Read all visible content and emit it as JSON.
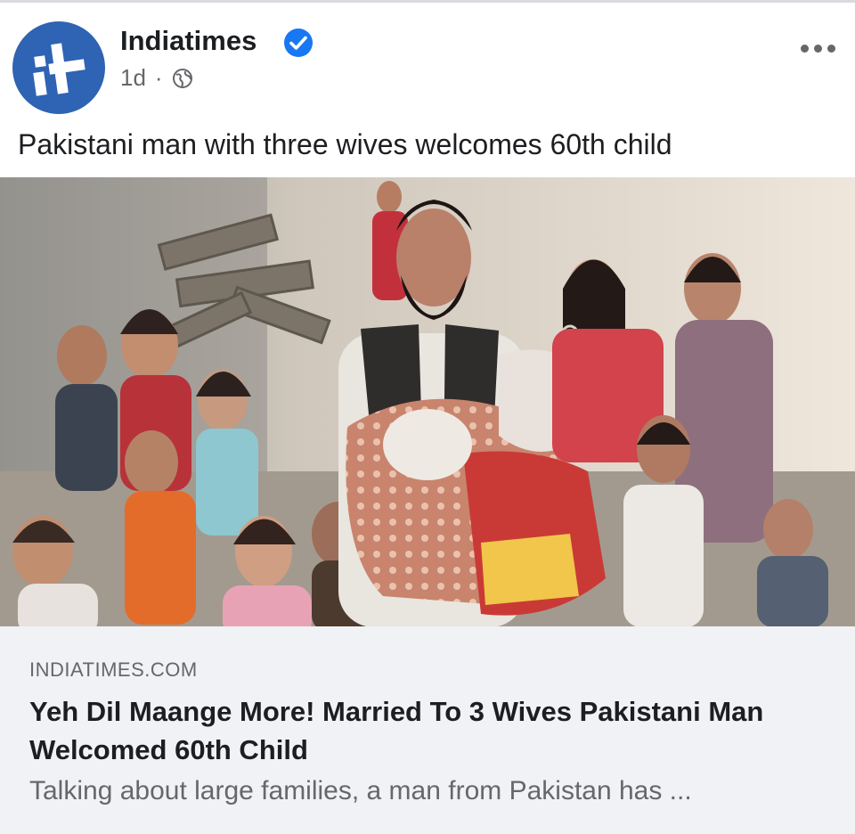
{
  "post": {
    "page_name": "Indiatimes",
    "time": "1d",
    "separator": "·",
    "privacy_icon": "globe-icon",
    "verified_icon": "verified-badge-icon",
    "more_icon": "more-options-icon",
    "text": "Pakistani man with three wives welcomes 60th child"
  },
  "link_preview": {
    "domain": "INDIATIMES.COM",
    "title": "Yeh Dil Maange More! Married To 3 Wives Pakistani Man Welcomed 60th Child",
    "description": "Talking about large families, a man from Pakistan has ..."
  },
  "colors": {
    "brand_blue": "#2f63b3",
    "verified_blue": "#1877f2",
    "card_bg": "#f0f2f5"
  }
}
